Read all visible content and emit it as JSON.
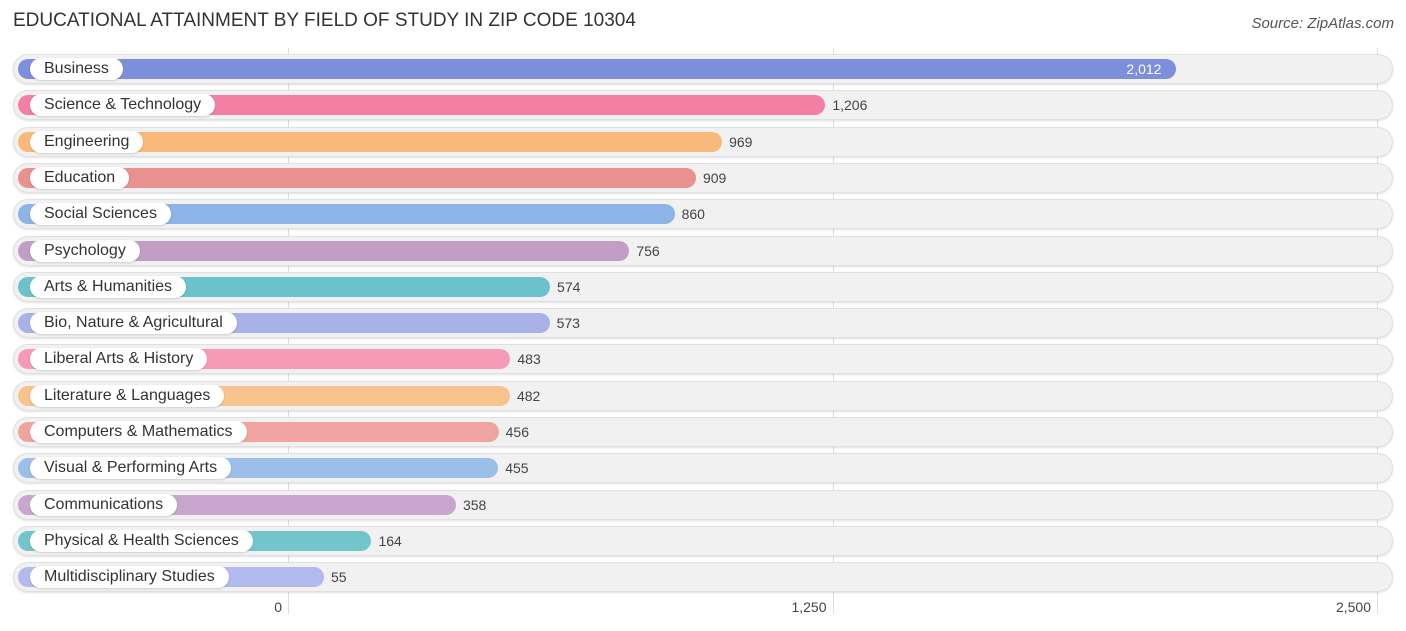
{
  "header": {
    "title": "EDUCATIONAL ATTAINMENT BY FIELD OF STUDY IN ZIP CODE 10304",
    "source": "Source: ZipAtlas.com"
  },
  "chart_data": {
    "type": "bar",
    "orientation": "horizontal",
    "title": "EDUCATIONAL ATTAINMENT BY FIELD OF STUDY IN ZIP CODE 10304",
    "xlabel": "",
    "ylabel": "",
    "xlim": [
      0,
      2500
    ],
    "grid": true,
    "ticks": [
      {
        "value": 0,
        "label": "0"
      },
      {
        "value": 1250,
        "label": "1,250"
      },
      {
        "value": 2500,
        "label": "2,500"
      }
    ],
    "categories": [
      "Business",
      "Science & Technology",
      "Engineering",
      "Education",
      "Social Sciences",
      "Psychology",
      "Arts & Humanities",
      "Bio, Nature & Agricultural",
      "Liberal Arts & History",
      "Literature & Languages",
      "Computers & Mathematics",
      "Visual & Performing Arts",
      "Communications",
      "Physical & Health Sciences",
      "Multidisciplinary Studies"
    ],
    "values": [
      2012,
      1206,
      969,
      909,
      860,
      756,
      574,
      573,
      483,
      482,
      456,
      455,
      358,
      164,
      55
    ],
    "value_labels": [
      "2,012",
      "1,206",
      "969",
      "909",
      "860",
      "756",
      "574",
      "573",
      "483",
      "482",
      "456",
      "455",
      "358",
      "164",
      "55"
    ],
    "colors": [
      "#7d8fdc",
      "#f47fa4",
      "#f9b97a",
      "#e8918f",
      "#8db4e6",
      "#c29dc6",
      "#6cc2cb",
      "#a8b1e8",
      "#f69ab8",
      "#f9c38e",
      "#f0a3a0",
      "#9bbfe8",
      "#c8a6cd",
      "#72c6cb",
      "#b2baed"
    ]
  }
}
